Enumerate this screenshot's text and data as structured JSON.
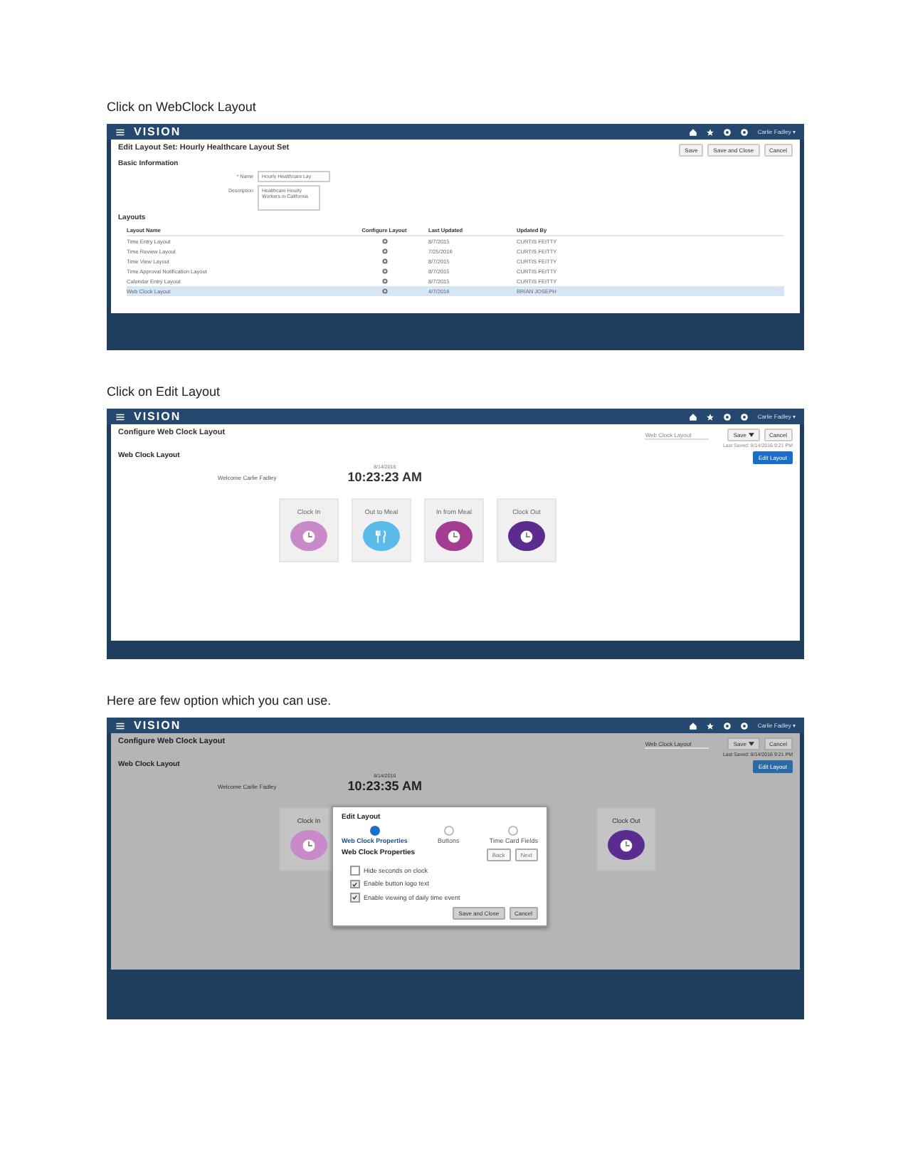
{
  "sections": [
    {
      "caption": "Click on WebClock Layout",
      "screen": {
        "kind": "layout_set",
        "brand": "VISION",
        "user": "Carlie Fadley ▾",
        "title": "Edit Layout Set: Hourly Healthcare Layout Set",
        "buttons": [
          "Save",
          "Save and Close",
          "Cancel"
        ],
        "subtitle": "Basic Information",
        "name_label": "* Name",
        "name_value": "Hourly Healthcare Lay",
        "description_label": "Description",
        "description_value": "Healthcare Hourly Workers in California",
        "table_title": "Layouts",
        "columns": [
          "Layout Name",
          "Configure Layout",
          "Last Updated",
          "Updated By"
        ],
        "rows": [
          {
            "name": "Time Entry Layout",
            "updated": "8/7/2015",
            "by": "CURTIS FEITTY",
            "selected": false
          },
          {
            "name": "Time Review Layout",
            "updated": "7/25/2016",
            "by": "CURTIS FEITTY",
            "selected": false
          },
          {
            "name": "Time View Layout",
            "updated": "8/7/2015",
            "by": "CURTIS FEITTY",
            "selected": false
          },
          {
            "name": "Time Approval Notification Layout",
            "updated": "8/7/2015",
            "by": "CURTIS FEITTY",
            "selected": false
          },
          {
            "name": "Calendar Entry Layout",
            "updated": "8/7/2015",
            "by": "CURTIS FEITTY",
            "selected": false
          },
          {
            "name": "Web Clock Layout",
            "updated": "4/7/2016",
            "by": "BRIAN JOSEPH",
            "selected": true
          }
        ]
      }
    },
    {
      "caption": "Click on Edit Layout",
      "screen": {
        "kind": "web_clock",
        "brand": "VISION",
        "user": "Carlie Fadley ▾",
        "title": "Configure Web Clock Layout",
        "select": "Web Clock Layout",
        "save": "Save",
        "cancel": "Cancel",
        "last_saved": "Last Saved: 8/14/2016 9:21 PM",
        "heading": "Web Clock Layout",
        "edit_button": "Edit Layout",
        "welcome": "Welcome Carlie Fadley",
        "date": "8/14/2016",
        "time": "10:23:23 AM",
        "tiles": [
          {
            "label": "Clock In",
            "kind": "clock",
            "color": "#c88ac8"
          },
          {
            "label": "Out to Meal",
            "kind": "meal",
            "color": "#5bbbe8"
          },
          {
            "label": "In from Meal",
            "kind": "clock",
            "color": "#a23d91"
          },
          {
            "label": "Clock Out",
            "kind": "clock",
            "color": "#5b2b8f"
          }
        ]
      }
    },
    {
      "caption": "Here are few option which you can use.",
      "screen": {
        "kind": "web_clock",
        "brand": "VISION",
        "user": "Carlie Fadley ▾",
        "title": "Configure Web Clock Layout",
        "select": "Web Clock Layout",
        "save": "Save",
        "cancel": "Cancel",
        "last_saved": "Last Saved: 8/14/2016 9:21 PM",
        "heading": "Web Clock Layout",
        "edit_button": "Edit Layout",
        "welcome": "Welcome Carlie Fadley",
        "date": "8/14/2016",
        "time": "10:23:35 AM",
        "tiles": [
          {
            "label": "Clock In",
            "kind": "clock",
            "color": "#c88ac8"
          },
          {
            "label": "Clock Out",
            "kind": "clock",
            "color": "#5b2b8f"
          }
        ],
        "dialog": {
          "title": "Edit Layout",
          "steps": [
            {
              "label": "Web Clock Properties",
              "selected": true
            },
            {
              "label": "Buttons",
              "selected": false
            },
            {
              "label": "Time Card Fields",
              "selected": false
            }
          ],
          "section": "Web Clock Properties",
          "back": "Back",
          "next": "Next",
          "options": [
            {
              "label": "Hide seconds on clock",
              "checked": false
            },
            {
              "label": "Enable button logo text",
              "checked": true
            },
            {
              "label": "Enable viewing of daily time event",
              "checked": true
            }
          ],
          "save": "Save and Close",
          "cancel": "Cancel"
        }
      }
    }
  ]
}
